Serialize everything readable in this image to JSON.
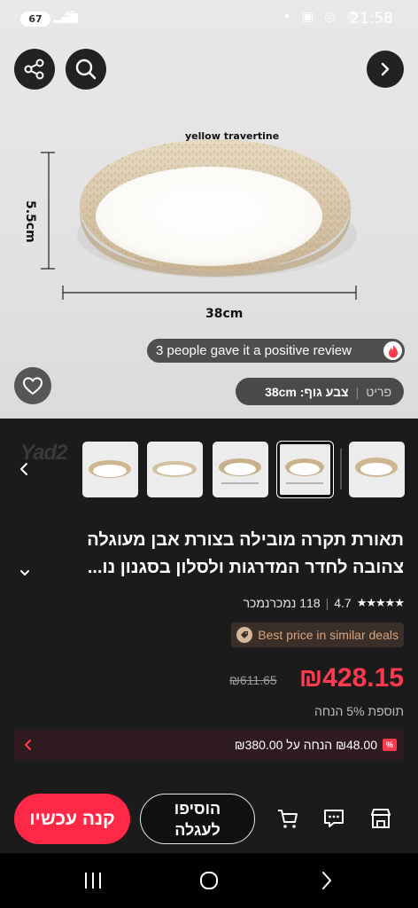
{
  "status_bar": {
    "battery": "67",
    "network": "4G",
    "time": "21:58"
  },
  "hero": {
    "image_label": "yellow travertine",
    "height_dimension": "5.5cm",
    "width_dimension": "38cm",
    "review_badge": "3 people gave it a positive review",
    "variant_label": "פריט",
    "variant_value": "צבע גוף: 38cm"
  },
  "thumbnails": {
    "watermark": "Yad2",
    "count": 5,
    "selected_index": 3
  },
  "product": {
    "title_line1": "תאורת תקרה מובילה בצורת אבן מעוגלה",
    "title_line2": "צהובה לחדר המדרגות ולסלון בסגנון נו...",
    "rating": "4.7",
    "sold_count": "118 נמכרנמכר",
    "best_price_text": "Best price in similar deals",
    "price": "₪428.15",
    "old_price": "₪611.65",
    "extra_discount": "תוספת 5% הנחה",
    "coupon_text": "₪48.00 הנחה על ₪380.00",
    "coupon_badge": "%"
  },
  "actions": {
    "buy_now": "קנה עכשיו",
    "add_to_cart": "הוסיפו לעגלה"
  },
  "colors": {
    "accent_red": "#ff2947",
    "price_red": "#ff3a4e",
    "background_dark": "#1b1b1b",
    "best_price_text": "#d7a57d"
  }
}
